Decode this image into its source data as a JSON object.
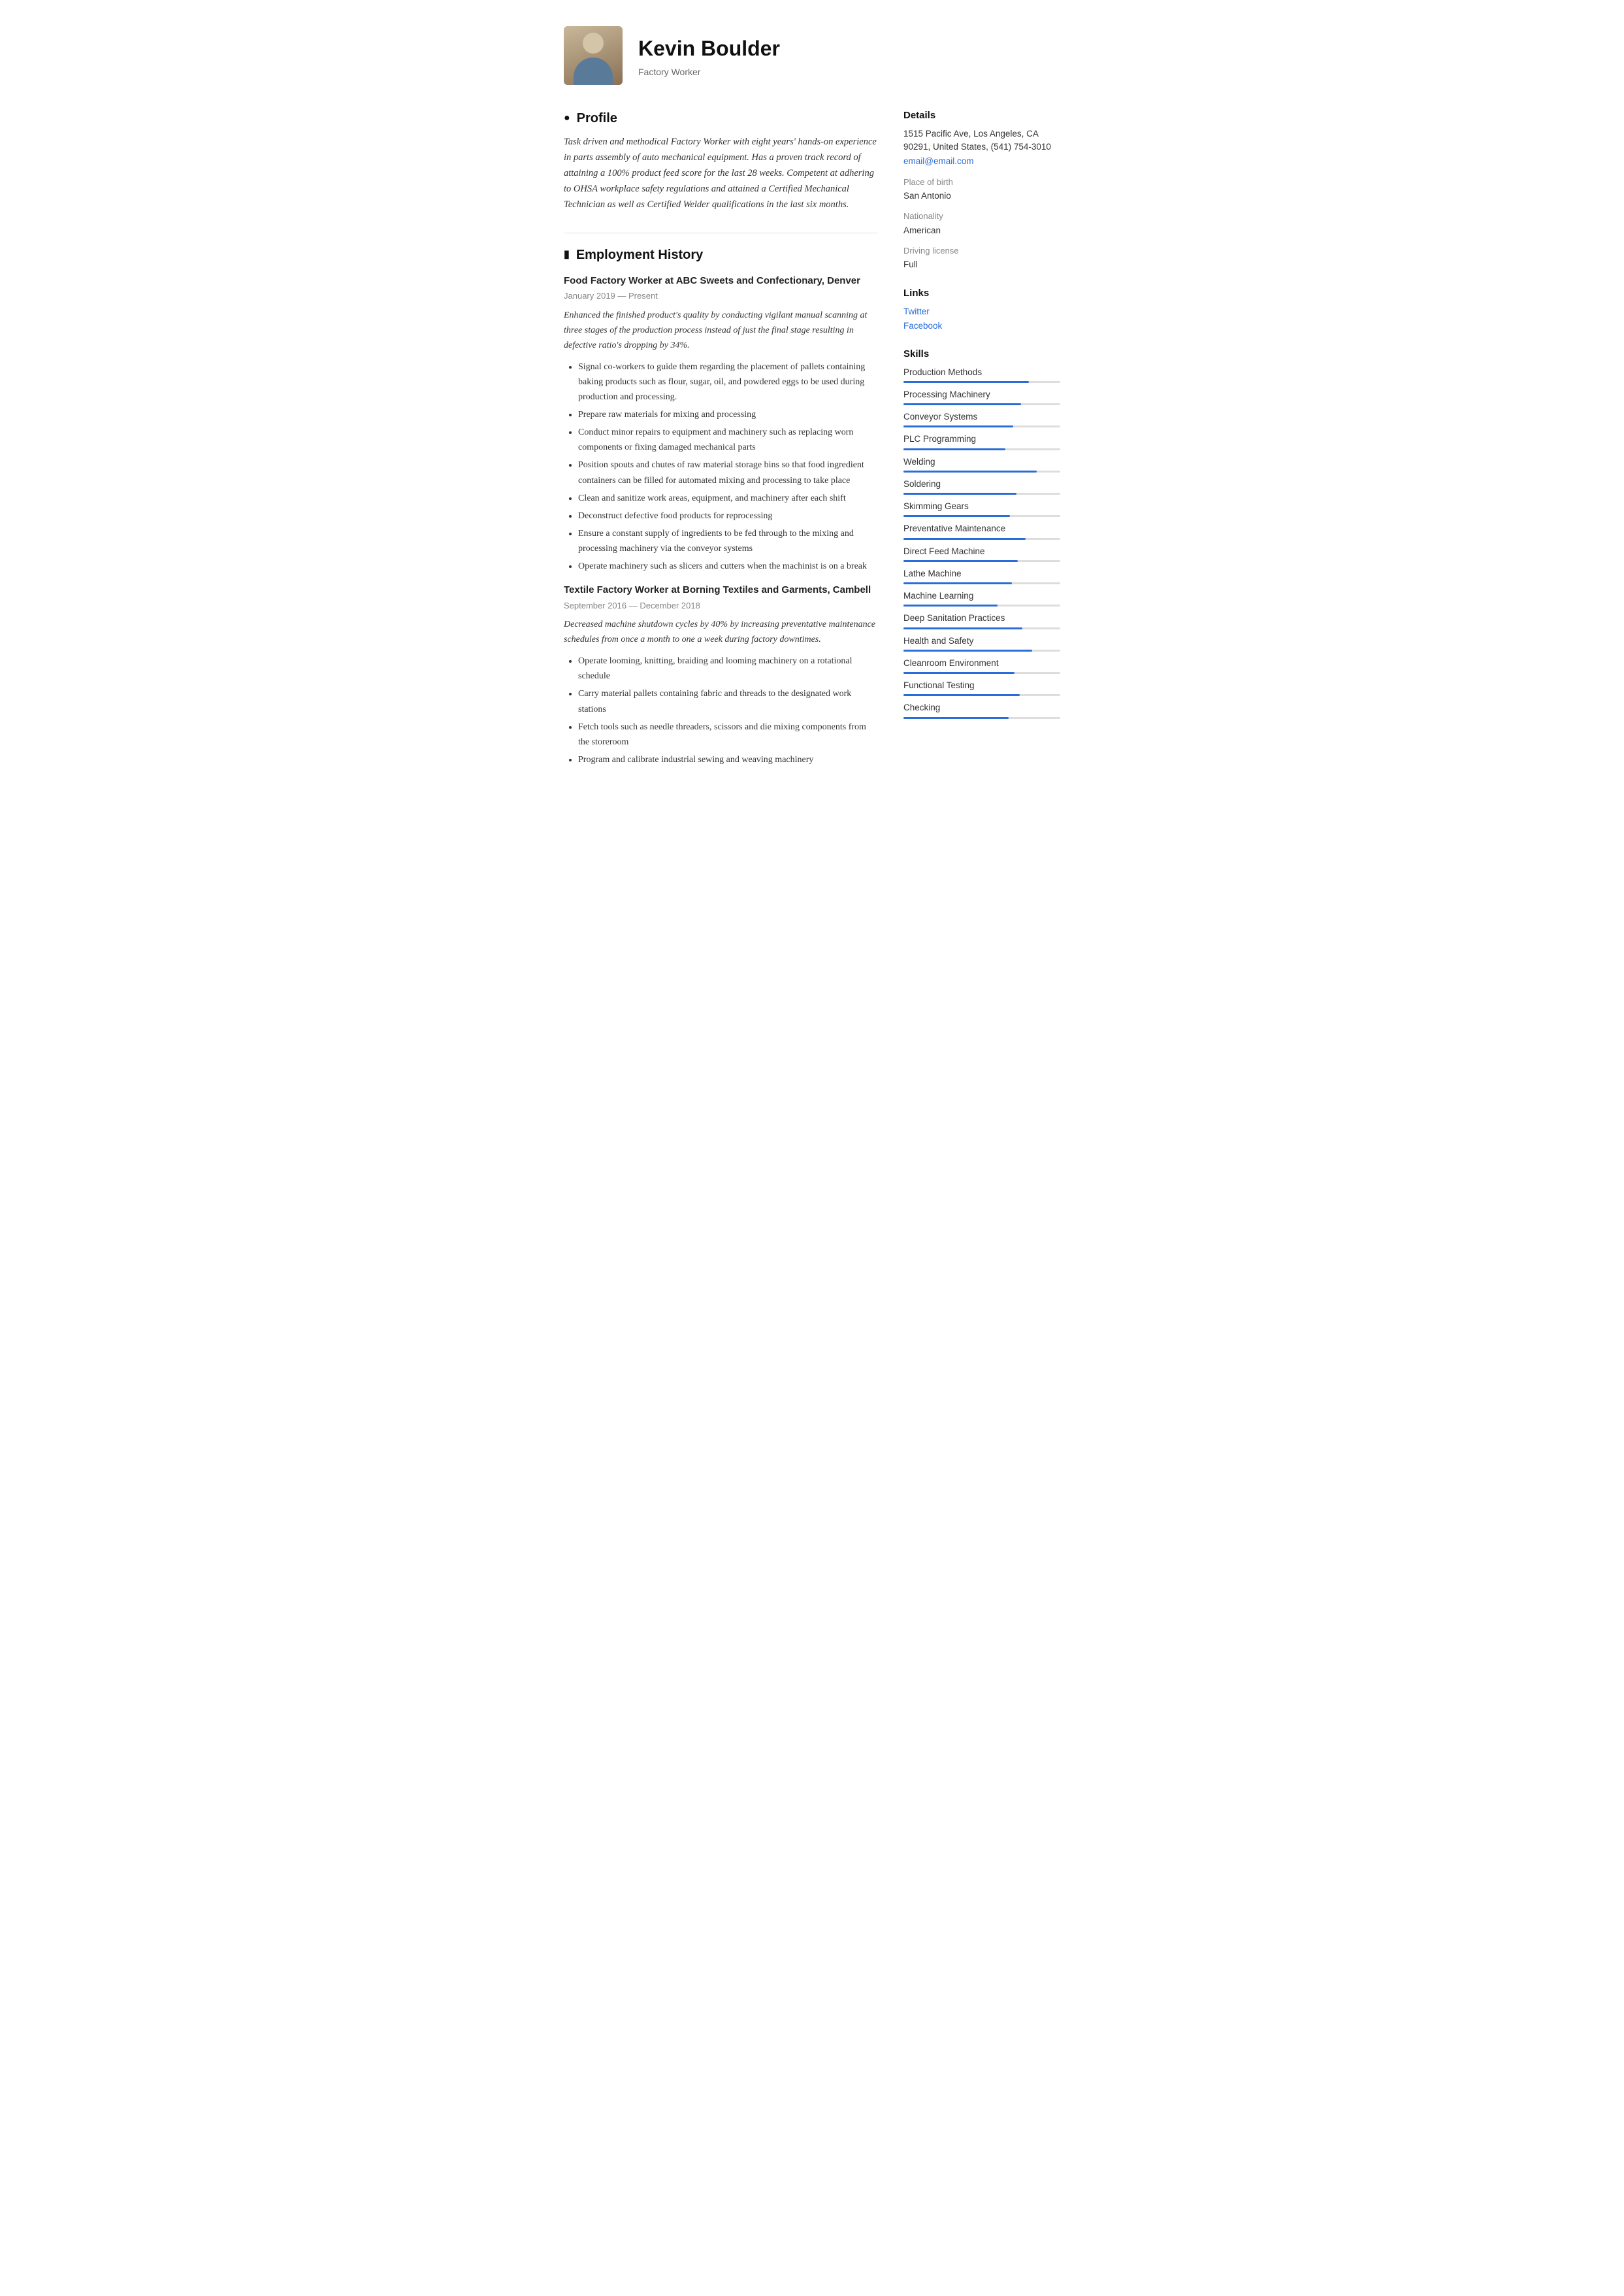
{
  "header": {
    "name": "Kevin Boulder",
    "job_title": "Factory Worker",
    "avatar_alt": "Kevin Boulder photo"
  },
  "profile": {
    "section_title": "Profile",
    "text": "Task driven and methodical Factory Worker with eight years' hands-on experience in parts assembly of auto mechanical equipment. Has a proven track record of attaining a 100% product feed score for the last 28 weeks. Competent at adhering to OHSA workplace safety regulations and attained a Certified Mechanical Technician as well as Certified Welder qualifications in the last six months."
  },
  "employment": {
    "section_title": "Employment History",
    "jobs": [
      {
        "title": "Food Factory Worker at  ABC Sweets and Confectionary, Denver",
        "date": "January 2019 — Present",
        "description": "Enhanced the finished product's quality by conducting vigilant manual scanning at three stages of the production process instead of just the final stage resulting in defective ratio's dropping by 34%.",
        "bullets": [
          "Signal co-workers to guide them regarding the placement of pallets containing baking products such as flour, sugar, oil, and powdered eggs to be used during production and processing.",
          "Prepare raw materials for mixing and processing",
          "Conduct minor repairs to equipment and machinery such as replacing worn components or fixing damaged mechanical parts",
          "Position spouts and chutes of raw material storage bins so that food ingredient containers can be filled for automated mixing and processing to take place",
          "Clean and sanitize work areas, equipment, and machinery after each shift",
          "Deconstruct defective food products for reprocessing",
          "Ensure a constant supply of ingredients to be fed through to the mixing and processing machinery via the conveyor systems",
          "Operate machinery such as slicers and cutters when the machinist is on a break"
        ]
      },
      {
        "title": "Textile Factory Worker at  Borning Textiles and Garments, Cambell",
        "date": "September 2016 — December 2018",
        "description": "Decreased machine shutdown cycles by 40% by increasing preventative maintenance schedules from once a month to one a week during factory downtimes.",
        "bullets": [
          "Operate looming, knitting, braiding and looming machinery on a rotational schedule",
          "Carry material pallets containing fabric and threads to the designated work stations",
          "Fetch tools such as needle threaders, scissors and die mixing components from the storeroom",
          "Program and calibrate industrial sewing and weaving machinery"
        ]
      }
    ]
  },
  "details": {
    "section_title": "Details",
    "address": "1515 Pacific Ave, Los Angeles, CA 90291, United States, (541) 754-3010",
    "email": "email@email.com",
    "place_of_birth_label": "Place of birth",
    "place_of_birth": "San Antonio",
    "nationality_label": "Nationality",
    "nationality": "American",
    "driving_license_label": "Driving license",
    "driving_license": "Full"
  },
  "links": {
    "section_title": "Links",
    "items": [
      {
        "label": "Twitter",
        "url": "#"
      },
      {
        "label": "Facebook",
        "url": "#"
      }
    ]
  },
  "skills": {
    "section_title": "Skills",
    "items": [
      {
        "name": "Production Methods",
        "width": "80"
      },
      {
        "name": "Processing Machinery",
        "width": "75"
      },
      {
        "name": "Conveyor Systems",
        "width": "70"
      },
      {
        "name": "PLC Programming",
        "width": "65"
      },
      {
        "name": "Welding",
        "width": "85"
      },
      {
        "name": "Soldering",
        "width": "72"
      },
      {
        "name": "Skimming Gears",
        "width": "68"
      },
      {
        "name": "Preventative Maintenance",
        "width": "78"
      },
      {
        "name": "Direct Feed Machine",
        "width": "73"
      },
      {
        "name": "Lathe Machine",
        "width": "69"
      },
      {
        "name": "Machine Learning",
        "width": "60"
      },
      {
        "name": "Deep Sanitation Practices",
        "width": "76"
      },
      {
        "name": "Health and Safety",
        "width": "82"
      },
      {
        "name": "Cleanroom Environment",
        "width": "71"
      },
      {
        "name": "Functional Testing",
        "width": "74"
      },
      {
        "name": "Checking",
        "width": "67"
      }
    ]
  }
}
